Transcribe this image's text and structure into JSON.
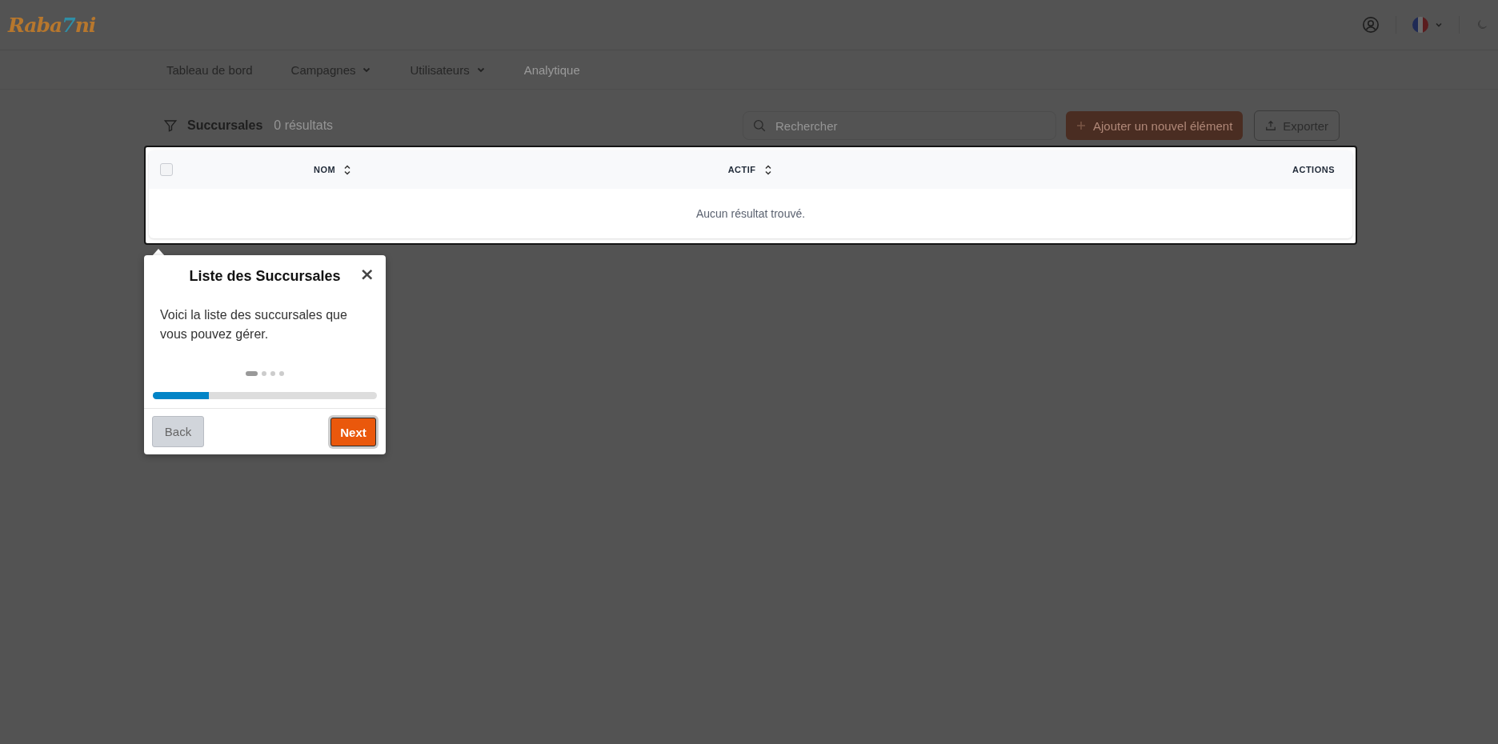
{
  "logo": [
    {
      "text": "Raba",
      "color": "#b7772d"
    },
    {
      "text": "7",
      "color": "#2f8ea6"
    },
    {
      "text": "ni",
      "color": "#b7772d"
    }
  ],
  "nav": [
    {
      "label": "Tableau de bord",
      "dropdown": false,
      "disabled": false
    },
    {
      "label": "Campagnes",
      "dropdown": true,
      "disabled": false
    },
    {
      "label": "Utilisateurs",
      "dropdown": true,
      "disabled": false
    },
    {
      "label": "Analytique",
      "dropdown": false,
      "disabled": true
    }
  ],
  "toolbar": {
    "title": "Succursales",
    "count": "0 résultats",
    "search": {
      "placeholder": "Rechercher"
    },
    "add_button": "Ajouter un nouvel élément",
    "export_button": "Exporter"
  },
  "table": {
    "select_all": {
      "checked": false
    },
    "columns": [
      {
        "label": "NOM",
        "sortable": true
      },
      {
        "label": "ACTIF",
        "sortable": true
      },
      {
        "label": "ACTIONS",
        "sortable": false
      }
    ],
    "empty": "Aucun résultat trouvé."
  },
  "tour": {
    "title": "Liste des Succursales",
    "close": "×",
    "text": "Voici la liste des succursales que vous pouvez gérer.",
    "steps": [
      {
        "selected": true
      },
      {
        "selected": false
      },
      {
        "selected": false
      },
      {
        "selected": false
      }
    ],
    "progress": {
      "level": 0.25
    },
    "back": "Back",
    "next": "Next"
  }
}
